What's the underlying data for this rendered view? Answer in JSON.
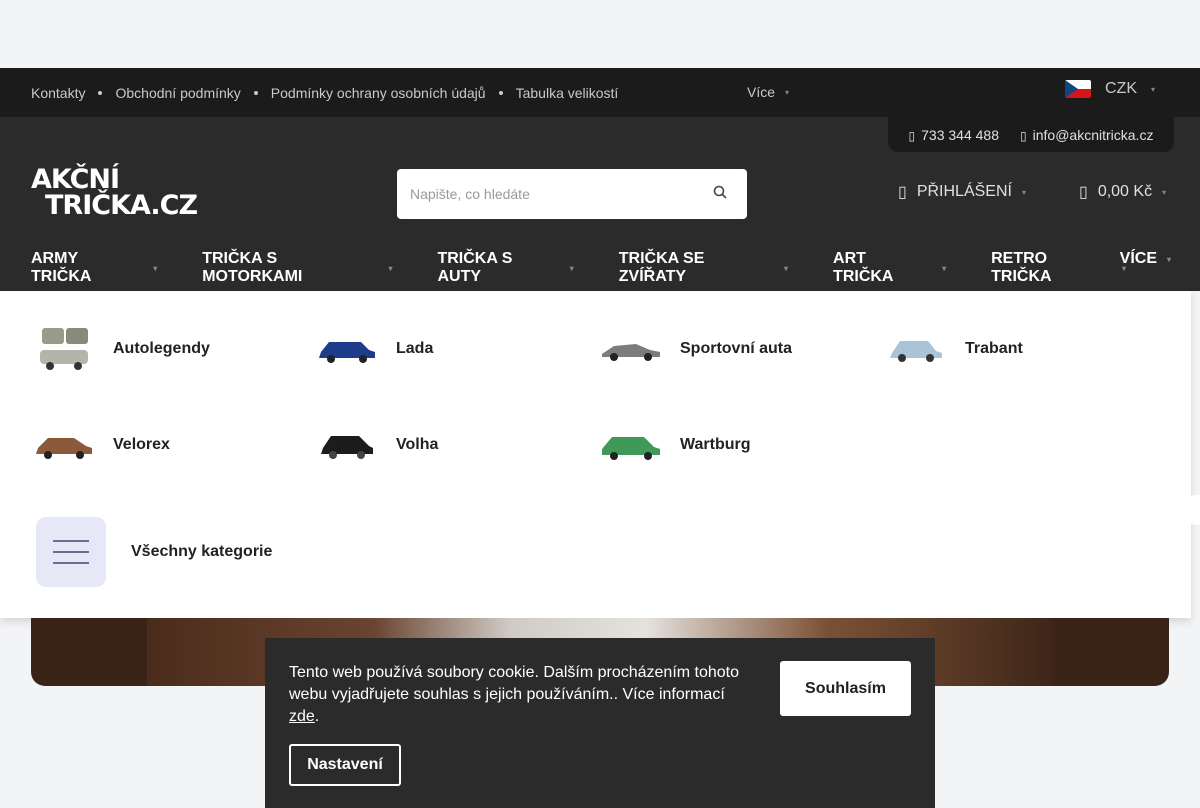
{
  "topbar": {
    "links": [
      "Kontakty",
      "Obchodní podmínky",
      "Podmínky ochrany osobních údajů",
      "Tabulka velikostí"
    ],
    "more_label": "Více",
    "currency": "CZK"
  },
  "header": {
    "phone": "733 344 488",
    "email": "info@akcnitricka.cz",
    "logo_line1": "AKČNÍ",
    "logo_line2": "TRIČKA.CZ",
    "search_placeholder": "Napište, co hledáte",
    "login_label": "PŘIHLÁŠENÍ",
    "cart_total": "0,00 Kč"
  },
  "nav": {
    "items": [
      "ARMY TRIČKA",
      "TRIČKA S MOTORKAMI",
      "TRIČKA S AUTY",
      "TRIČKA SE ZVÍŘATY",
      "ART TRIČKA",
      "RETRO TRIČKA"
    ],
    "more_label": "VÍCE"
  },
  "mega_menu": {
    "categories": [
      "Autolegendy",
      "Lada",
      "Sportovní auta",
      "Trabant",
      "Velorex",
      "Volha",
      "Wartburg"
    ],
    "all_categories": "Všechny kategorie"
  },
  "cookie_bar": {
    "text": "Tento web používá soubory cookie. Dalším procházením tohoto webu vyjadřujete souhlas s jejich používáním.. Více informací",
    "link_text": "zde",
    "after_link": ".",
    "agree_label": "Souhlasím",
    "settings_label": "Nastavení"
  }
}
